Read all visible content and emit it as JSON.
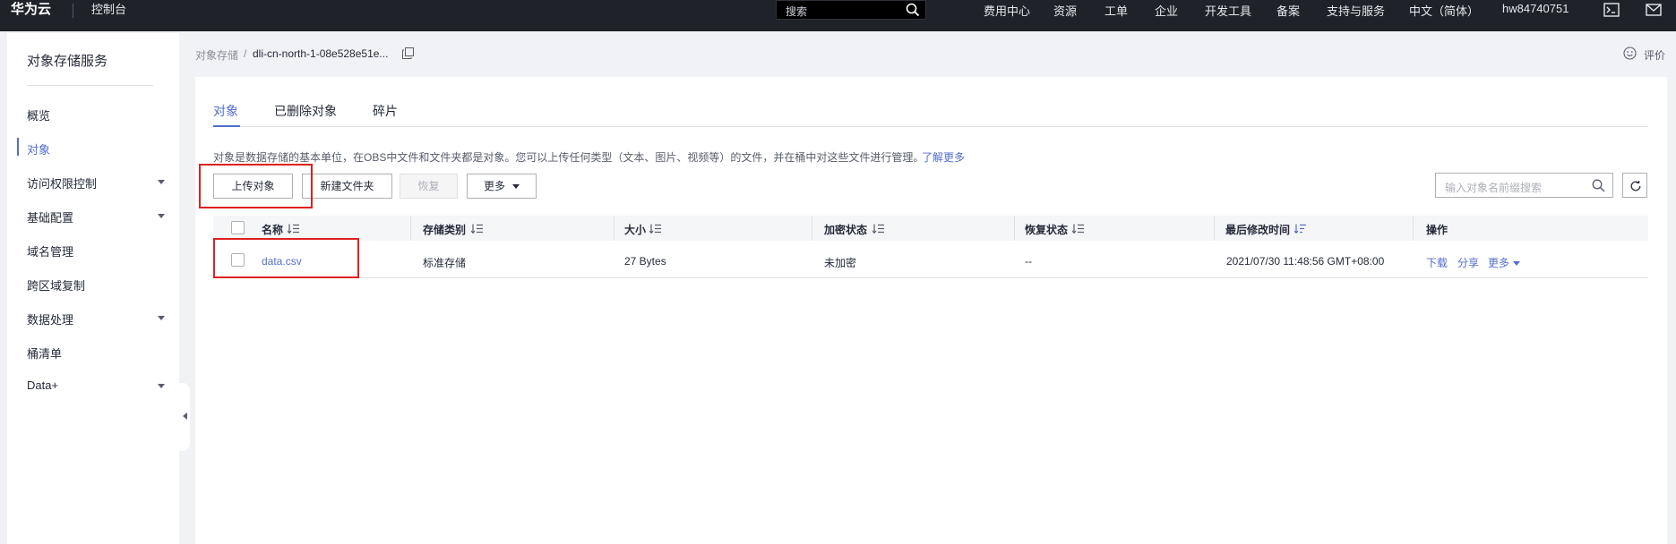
{
  "topbar": {
    "brand": "华为云",
    "console": "控制台",
    "search_placeholder": "搜索",
    "nav": [
      "费用中心",
      "资源",
      "工单",
      "企业",
      "开发工具",
      "备案",
      "支持与服务",
      "中文（简体）",
      "hw84740751"
    ]
  },
  "sidebar": {
    "title": "对象存储服务",
    "items": [
      {
        "label": "概览",
        "expandable": false,
        "active": false
      },
      {
        "label": "对象",
        "expandable": false,
        "active": true
      },
      {
        "label": "访问权限控制",
        "expandable": true,
        "active": false
      },
      {
        "label": "基础配置",
        "expandable": true,
        "active": false
      },
      {
        "label": "域名管理",
        "expandable": false,
        "active": false
      },
      {
        "label": "跨区域复制",
        "expandable": false,
        "active": false
      },
      {
        "label": "数据处理",
        "expandable": true,
        "active": false
      },
      {
        "label": "桶清单",
        "expandable": false,
        "active": false
      },
      {
        "label": "Data+",
        "expandable": true,
        "active": false
      }
    ]
  },
  "breadcrumb": {
    "root": "对象存储",
    "separator": "/",
    "current": "dli-cn-north-1-08e528e51e..."
  },
  "header": {
    "rate_label": "评价"
  },
  "tabs": [
    {
      "label": "对象",
      "active": true
    },
    {
      "label": "已删除对象",
      "active": false
    },
    {
      "label": "碎片",
      "active": false
    }
  ],
  "description": {
    "text": "对象是数据存储的基本单位，在OBS中文件和文件夹都是对象。您可以上传任何类型（文本、图片、视频等）的文件，并在桶中对这些文件进行管理。",
    "link": "了解更多"
  },
  "toolbar": {
    "upload": "上传对象",
    "new_folder": "新建文件夹",
    "restore": "恢复",
    "more": "更多",
    "search_placeholder": "输入对象名前缀搜索"
  },
  "table": {
    "columns": [
      "名称",
      "存储类别",
      "大小",
      "加密状态",
      "恢复状态",
      "最后修改时间",
      "操作"
    ],
    "rows": [
      {
        "name": "data.csv",
        "storage_class": "标准存储",
        "size": "27 Bytes",
        "encryption": "未加密",
        "restore_status": "--",
        "modified": "2021/07/30 11:48:56 GMT+08:00",
        "actions": [
          "下载",
          "分享",
          "更多"
        ]
      }
    ]
  },
  "colors": {
    "accent": "#526ecc",
    "topbar": "#1f2329",
    "highlight": "#e02020"
  }
}
